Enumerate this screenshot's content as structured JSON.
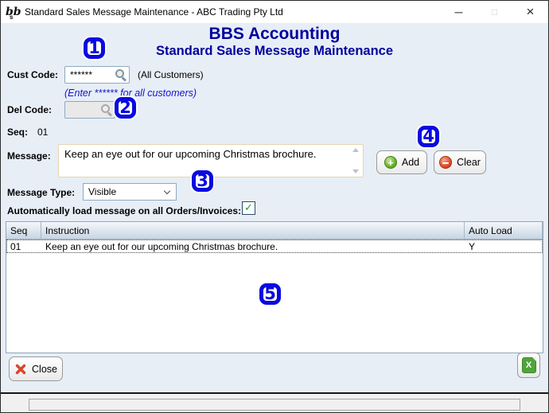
{
  "window": {
    "title": "Standard Sales Message Maintenance - ABC Trading Pty Ltd",
    "icon_text": "bb",
    "icon_sub": "s"
  },
  "icons": {
    "minimize": "─",
    "maximize": "□",
    "close_window": "×",
    "checkbox_check": "✓",
    "excel_letter": "X",
    "add": "+"
  },
  "header": {
    "app_name": "BBS Accounting",
    "screen_title": "Standard Sales Message Maintenance"
  },
  "form": {
    "cust_code_label": "Cust Code:",
    "cust_code_value": "******",
    "cust_code_suffix": "(All Customers)",
    "cust_code_hint": "(Enter ****** for all customers)",
    "del_code_label": "Del Code:",
    "del_code_value": "",
    "seq_label": "Seq:",
    "seq_value": "01",
    "message_label": "Message:",
    "message_value": "Keep an eye out for our upcoming Christmas brochure.",
    "message_type_label": "Message Type:",
    "message_type_value": "Visible",
    "auto_load_label": "Automatically load message on all Orders/Invoices:"
  },
  "buttons": {
    "add": "Add",
    "clear": "Clear",
    "close": "Close"
  },
  "table": {
    "columns": [
      "Seq",
      "Instruction",
      "Auto Load"
    ],
    "rows": [
      [
        "01",
        "Keep an eye out for our upcoming Christmas brochure.",
        "Y"
      ]
    ]
  },
  "annotations": [
    "1",
    "2",
    "3",
    "4",
    "5"
  ],
  "colors": {
    "heading_navy": "#00009c",
    "hint_blue": "#1414cc",
    "annotation_blue": "#0a0ae0",
    "content_bg": "#e7eef6",
    "add_green": "#5fae24",
    "clear_red": "#d9452f",
    "close_red": "#d9452f",
    "excel_green": "#51a33a",
    "check_green": "#1f9d2f"
  }
}
